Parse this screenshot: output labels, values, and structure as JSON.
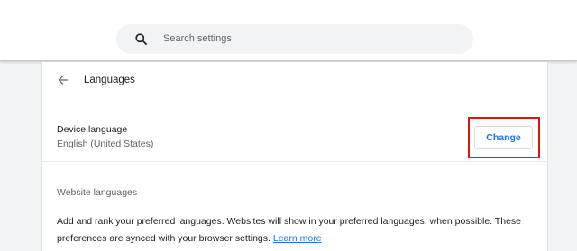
{
  "search": {
    "placeholder": "Search settings",
    "icon": "search-icon"
  },
  "header": {
    "title": "Languages",
    "back_icon": "arrow-back-icon"
  },
  "device_language": {
    "label": "Device language",
    "value": "English (United States)",
    "button_label": "Change"
  },
  "website_languages": {
    "title": "Website languages",
    "description": "Add and rank your preferred languages. Websites will show in your preferred languages, when possible. These preferences are synced with your browser settings. ",
    "link_label": "Learn more"
  },
  "colors": {
    "accent": "#1a73e8",
    "highlight": "#e3140f",
    "background": "#f1f3f4"
  }
}
